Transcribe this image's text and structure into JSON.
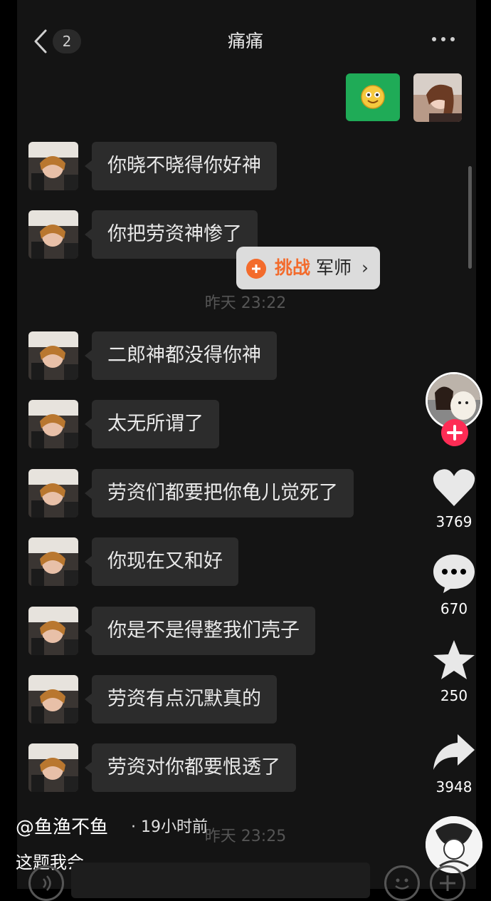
{
  "chat": {
    "unread_count": "2",
    "title": "痛痛",
    "messages_before": [
      {
        "text": "你晓不晓得你好神"
      },
      {
        "text": "你把劳资神惨了"
      }
    ],
    "timestamp_1": "昨天 23:22",
    "messages_after": [
      {
        "text": "二郎神都没得你神"
      },
      {
        "text": "太无所谓了"
      },
      {
        "text": "劳资们都要把你龟儿觉死了"
      },
      {
        "text": "你现在又和好"
      },
      {
        "text": "你是不是得整我们壳子"
      },
      {
        "text": "劳资有点沉默真的"
      },
      {
        "text": "劳资对你都要恨透了"
      }
    ],
    "timestamp_2": "昨天 23:25"
  },
  "challenge": {
    "orange_text": "挑战",
    "black_text": "军师",
    "chevron": "›"
  },
  "actions": {
    "likes": "3769",
    "comments": "670",
    "favorites": "250",
    "shares": "3948"
  },
  "post": {
    "author": "@鱼渔不鱼",
    "time": "· 19小时前",
    "caption": "这题我会"
  },
  "colors": {
    "sent_bubble": "#1fab57",
    "received_bubble": "#2c2c2c",
    "follow": "#fe2c55",
    "challenge_accent": "#f36b2c"
  },
  "icons": [
    "back-icon",
    "search-icon",
    "chevron-left-icon",
    "more-icon",
    "heart-icon",
    "comment-icon",
    "star-icon",
    "share-icon",
    "plus-icon",
    "voice-icon",
    "emoji-icon",
    "add-icon"
  ]
}
